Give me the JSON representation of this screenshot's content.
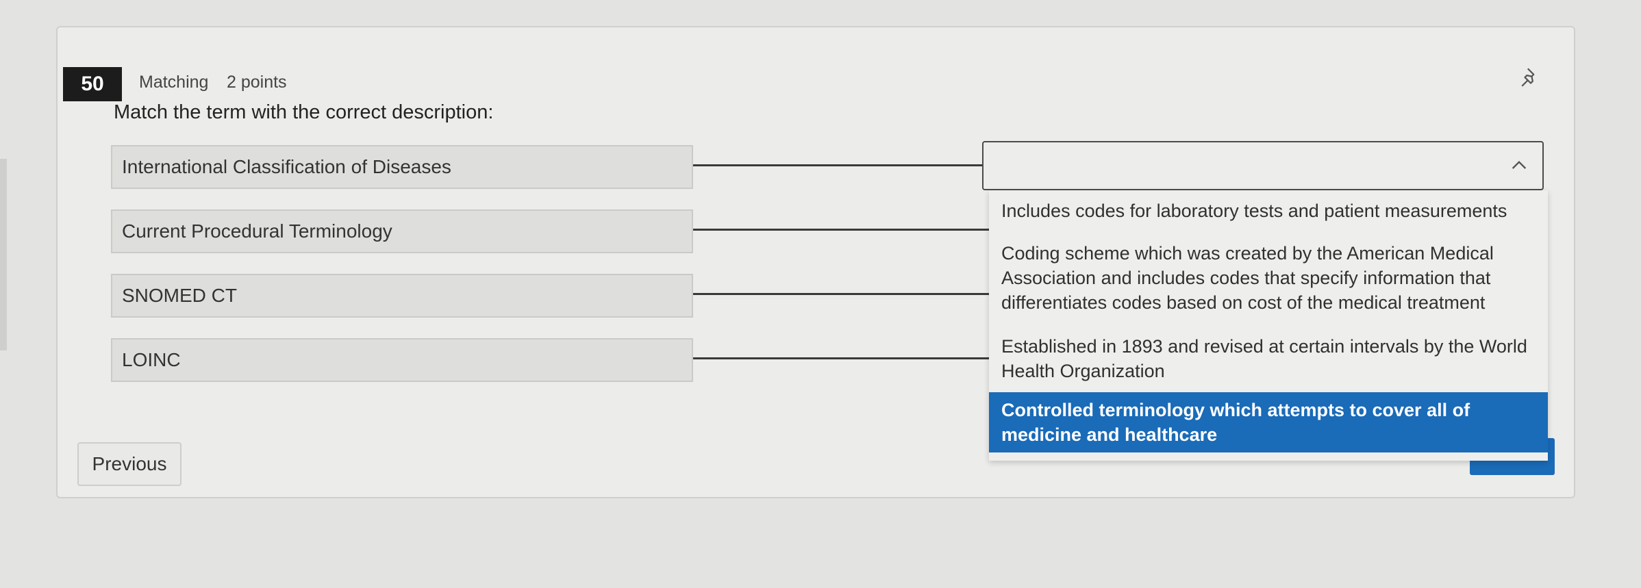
{
  "question": {
    "number": "50",
    "type": "Matching",
    "points": "2 points",
    "prompt": "Match the term with the correct description:"
  },
  "terms": [
    {
      "label": "International Classification of Diseases"
    },
    {
      "label": "Current Procedural Terminology"
    },
    {
      "label": "SNOMED CT"
    },
    {
      "label": "LOINC"
    }
  ],
  "dropdown": {
    "selected_value": "",
    "options": [
      "Includes codes for laboratory tests and patient measurements",
      "Coding scheme which was created by the American Medical Association and includes codes that specify information that differentiates codes based on cost of the medical treatment",
      "Established in 1893 and revised at certain intervals by the World Health Organization",
      "Controlled terminology which attempts to cover all of medicine and healthcare"
    ],
    "highlighted_index": 3
  },
  "buttons": {
    "previous": "Previous"
  },
  "icons": {
    "pin": "pin-icon",
    "chevron": "chevron-up-icon"
  },
  "colors": {
    "accent": "#1a6bb8",
    "number_badge": "#1c1c1c"
  }
}
